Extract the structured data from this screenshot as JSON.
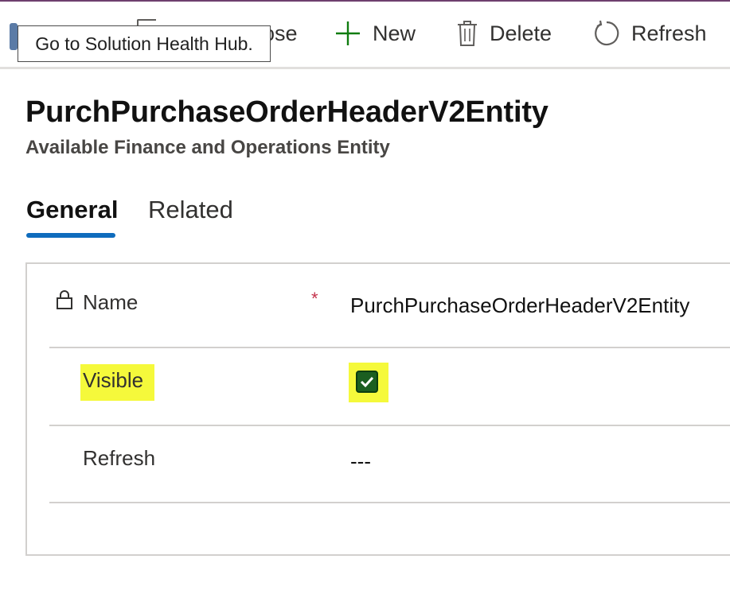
{
  "toolbar": {
    "close_partial_label": "ose",
    "new_label": "New",
    "delete_label": "Delete",
    "refresh_label": "Refresh"
  },
  "tooltip": {
    "text": "Go to Solution Health Hub."
  },
  "header": {
    "title": "PurchPurchaseOrderHeaderV2Entity",
    "subtitle": "Available Finance and Operations Entity"
  },
  "tabs": [
    {
      "label": "General",
      "selected": true
    },
    {
      "label": "Related",
      "selected": false
    }
  ],
  "form": {
    "fields": [
      {
        "label": "Name",
        "locked": true,
        "required_marker": "*",
        "value": "PurchPurchaseOrderHeaderV2Entity"
      },
      {
        "label": "Visible",
        "checked": true,
        "highlighted": true
      },
      {
        "label": "Refresh",
        "value": "---"
      }
    ]
  },
  "colors": {
    "accent": "#0f6cbd",
    "new_icon": "#107c10",
    "highlight": "#f5f93b",
    "checkbox": "#1b5e20",
    "required": "#c4314b"
  },
  "icons": [
    "health-hub-icon",
    "save-icon",
    "add-icon",
    "delete-icon",
    "refresh-icon",
    "lock-icon",
    "checkmark-icon"
  ]
}
